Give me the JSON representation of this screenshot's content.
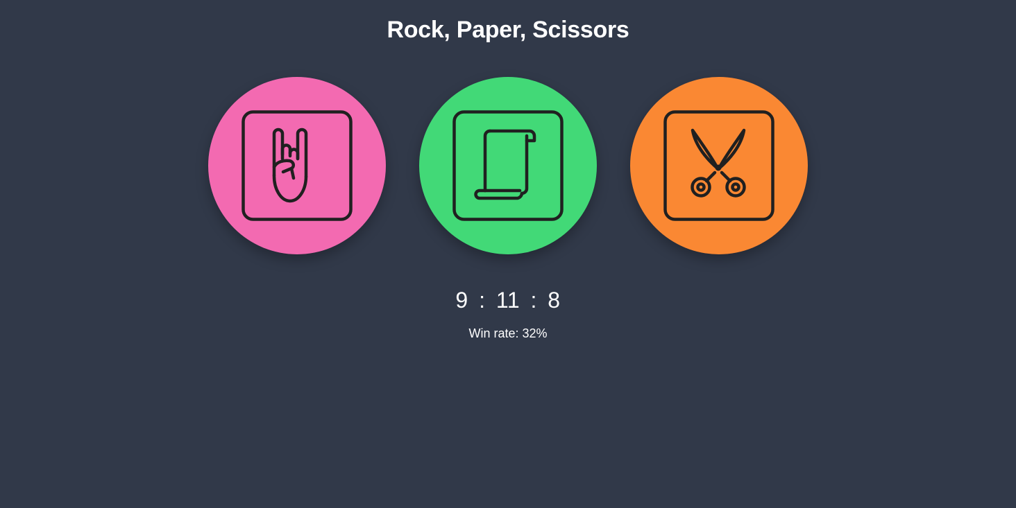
{
  "title": "Rock, Paper, Scissors",
  "choices": [
    {
      "name": "rock",
      "icon": "rock-hand-icon",
      "color": "#f36ab1"
    },
    {
      "name": "paper",
      "icon": "scroll-icon",
      "color": "#42d977"
    },
    {
      "name": "scissors",
      "icon": "scissors-icon",
      "color": "#fa8833"
    }
  ],
  "score": {
    "wins": "9",
    "separator": ":",
    "draws": "11",
    "losses": "8"
  },
  "win_rate_text": "Win rate: 32%",
  "colors": {
    "background": "#313949",
    "icon_stroke": "#202020",
    "text": "#ffffff"
  }
}
